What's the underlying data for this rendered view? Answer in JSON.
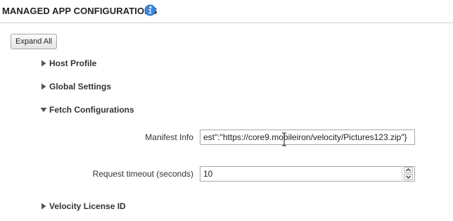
{
  "header": {
    "title": "MANAGED APP CONFIGURATIONS",
    "info_icon": "info-icon"
  },
  "toolbar": {
    "expand_all_label": "Expand All"
  },
  "sections": [
    {
      "label": "Host Profile",
      "expanded": false
    },
    {
      "label": "Global Settings",
      "expanded": false
    },
    {
      "label": "Fetch Configurations",
      "expanded": true
    },
    {
      "label": "Velocity License ID",
      "expanded": false
    }
  ],
  "fetch_configurations": {
    "manifest_info": {
      "label": "Manifest Info",
      "value": "est\":\"https://core9.mobileiron/velocity/Pictures123.zip\"}"
    },
    "request_timeout": {
      "label": "Request timeout (seconds)",
      "value": "10"
    }
  },
  "colors": {
    "info_icon_blue": "#2a72c8",
    "border": "#a9a9a9",
    "text": "#333333"
  }
}
